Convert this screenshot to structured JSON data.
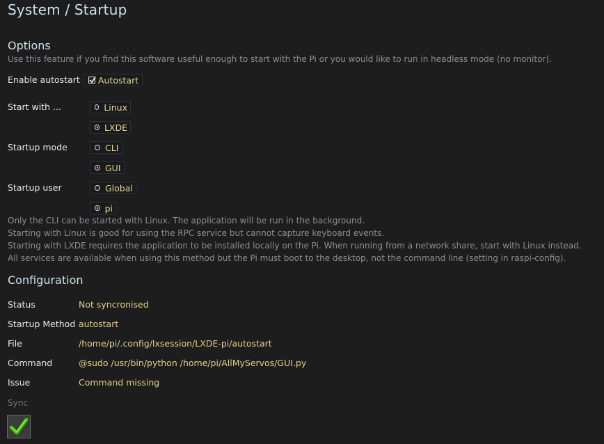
{
  "page": {
    "title": "System / Startup"
  },
  "options": {
    "heading": "Options",
    "description": "Use this feature if you find this software useful enough to start with the Pi or you would like to run in headless mode (no monitor).",
    "enable_autostart": {
      "label": "Enable autostart",
      "checkbox_label": "Autostart",
      "checked": true
    },
    "start_with": {
      "label": "Start with ...",
      "choices": [
        "Linux",
        "LXDE"
      ],
      "selected": "LXDE"
    },
    "startup_mode": {
      "label": "Startup mode",
      "choices": [
        "CLI",
        "GUI"
      ],
      "selected": "GUI"
    },
    "startup_user": {
      "label": "Startup user",
      "choices": [
        "Global",
        "pi"
      ],
      "selected": "pi"
    },
    "notes": [
      "Only the CLI can be started with Linux. The application will be run in the background.",
      "Starting with Linux is good for using the RPC service but cannot capture keyboard events.",
      "Starting with LXDE requires the application to be installed locally on the Pi. When running from a network share, start with Linux instead.",
      "All services are available when using this method but the Pi must boot to the desktop, not the command line (setting in raspi-config)."
    ]
  },
  "configuration": {
    "heading": "Configuration",
    "rows": [
      {
        "label": "Status",
        "value": "Not syncronised"
      },
      {
        "label": "Startup Method",
        "value": "autostart"
      },
      {
        "label": "File",
        "value": "/home/pi/.config/lxsession/LXDE-pi/autostart"
      },
      {
        "label": "Command",
        "value": "@sudo /usr/bin/python /home/pi/AllMyServos/GUI.py"
      },
      {
        "label": "Issue",
        "value": "Command missing"
      }
    ]
  },
  "sync": {
    "label": "Sync",
    "icon": "checkmark-icon"
  },
  "colors": {
    "background": "#1d1d1d",
    "value_text": "#e0cf8a",
    "heading_text": "#cfe3ec",
    "muted_text": "#8a8f93",
    "check_green": "#4fc21a"
  }
}
